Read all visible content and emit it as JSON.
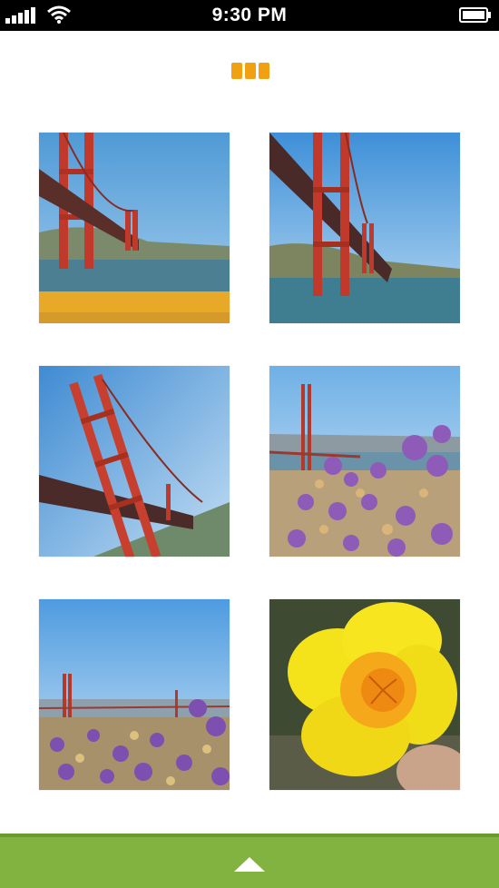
{
  "status_bar": {
    "time": "9:30 PM",
    "icons": [
      "signal-icon",
      "wifi-icon",
      "battery-icon"
    ]
  },
  "page_indicator": {
    "icon": "menu-grid-icon",
    "color": "#f0a010"
  },
  "photos": [
    {
      "subject": "golden-gate-bridge-tower-sand"
    },
    {
      "subject": "golden-gate-bridge-under-view"
    },
    {
      "subject": "golden-gate-bridge-tilted"
    },
    {
      "subject": "bridge-with-purple-flowers"
    },
    {
      "subject": "bridge-distant-flowers-field"
    },
    {
      "subject": "yellow-poppy-flower"
    }
  ],
  "bottom_bar": {
    "icon": "up-arrow-icon",
    "color": "#82b341"
  }
}
